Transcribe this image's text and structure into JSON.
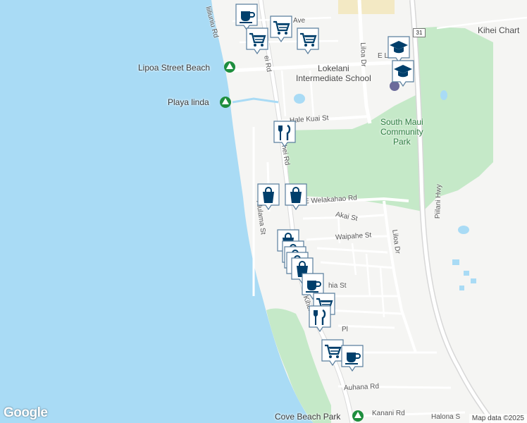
{
  "map": {
    "colors": {
      "water": "#a9dbf5",
      "land": "#f5f5f3",
      "park": "#c5e9c8",
      "road": "#ffffff",
      "highway": "#d7d7d7",
      "marker": "#003f6b",
      "marker_bg": "#ffffff"
    },
    "labels": {
      "lipoa_beach": "Lipoa Street Beach",
      "playa_linda": "Playa linda",
      "lokelani_line1": "Lokelani",
      "lokelani_line2": "Intermediate School",
      "south_maui_line1": "South Maui",
      "south_maui_line2": "Community",
      "south_maui_line3": "Park",
      "kihei_charter": "Kihei Chart",
      "cove_beach": "Cove Beach Park",
      "iliili_rd": "liiliuniu Rd",
      "lipoa_pkwy": "Ave",
      "kihei_rd_top": "ei Rd",
      "kihei_rd_mid": "hei Rd",
      "hale_kuai": "Hale Kuai St",
      "welakahao": "E Welakahao Rd",
      "akai": "Akai St",
      "waipahe": "Waipahe St",
      "liloa_top": "Liloa Dr",
      "liloa_mid": "Liloa Dr",
      "alulama": "Alulama St",
      "piilani": "Piilani Hwy",
      "e_lipoa": "E L",
      "auhana": "Auhana Rd",
      "kanani": "Kanani Rd",
      "halona": "Halona S",
      "kihei_rd_low": "Kihei",
      "hia_st": "hia St",
      "pl": "Pl",
      "route_31": "31"
    },
    "markers": [
      {
        "icon": "coffee-icon"
      },
      {
        "icon": "cart-icon"
      },
      {
        "icon": "cart-icon"
      },
      {
        "icon": "cart-icon"
      },
      {
        "icon": "school-icon"
      },
      {
        "icon": "school-icon"
      },
      {
        "icon": "restaurant-icon"
      },
      {
        "icon": "shopping-bag-icon"
      },
      {
        "icon": "shopping-bag-icon"
      },
      {
        "icon": "shopping-bag-icon"
      },
      {
        "icon": "shopping-bag-icon"
      },
      {
        "icon": "shopping-bag-icon"
      },
      {
        "icon": "shopping-bag-icon"
      },
      {
        "icon": "shopping-bag-icon"
      },
      {
        "icon": "coffee-icon"
      },
      {
        "icon": "cart-icon"
      },
      {
        "icon": "restaurant-icon"
      },
      {
        "icon": "cart-icon"
      },
      {
        "icon": "coffee-icon"
      }
    ],
    "logo": "Google",
    "attribution": "Map data ©2025"
  }
}
